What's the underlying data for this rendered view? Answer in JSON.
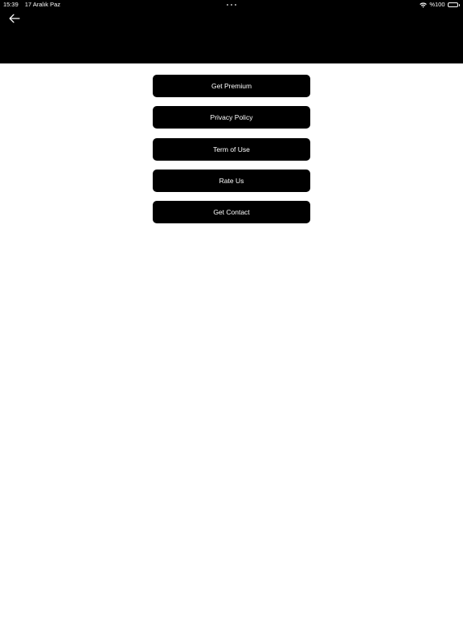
{
  "status_bar": {
    "time": "15:39",
    "date": "17 Aralık Paz",
    "battery_text": "%100",
    "wifi_icon": "wifi-icon",
    "battery_icon": "battery-full-icon"
  },
  "header": {
    "back_icon": "arrow-left-icon"
  },
  "menu": {
    "items": [
      {
        "label": "Get Premium"
      },
      {
        "label": "Privacy Policy"
      },
      {
        "label": "Term of Use"
      },
      {
        "label": "Rate Us"
      },
      {
        "label": "Get Contact"
      }
    ]
  },
  "colors": {
    "header_background": "#000000",
    "page_background": "#ffffff",
    "button_background": "#000000",
    "button_text": "#ffffff"
  }
}
